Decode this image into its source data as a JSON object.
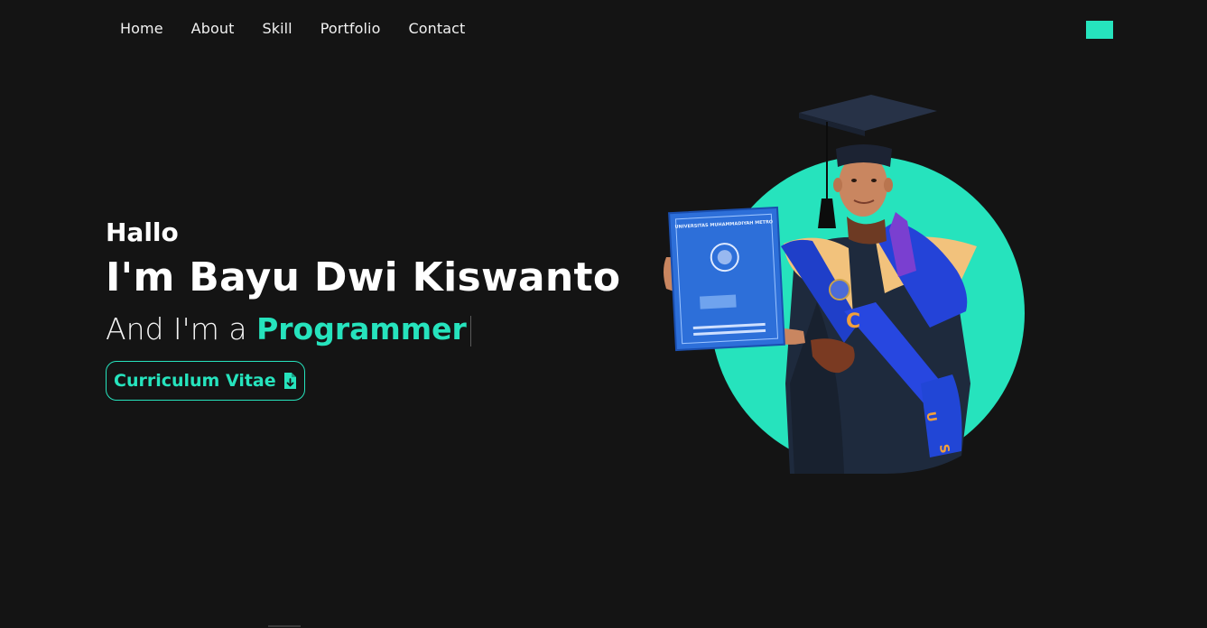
{
  "nav": {
    "items": [
      {
        "label": "Home"
      },
      {
        "label": "About"
      },
      {
        "label": "Skill"
      },
      {
        "label": "Portfolio"
      },
      {
        "label": "Contact"
      }
    ],
    "toggle_icon": "menu-toggle-icon"
  },
  "hero": {
    "greeting": "Hallo",
    "name": "I'm Bayu Dwi Kiswanto",
    "role_prefix": "And I'm a ",
    "role_word": "Programmer",
    "cv_button_label": "Curriculum Vitae",
    "cv_button_icon": "file-download-icon"
  },
  "photo": {
    "book_title": "UNIVERSITAS MUHAMMADIYAH METRO"
  },
  "colors": {
    "accent": "#26e3bd",
    "background": "#141414",
    "text": "#ffffff"
  }
}
